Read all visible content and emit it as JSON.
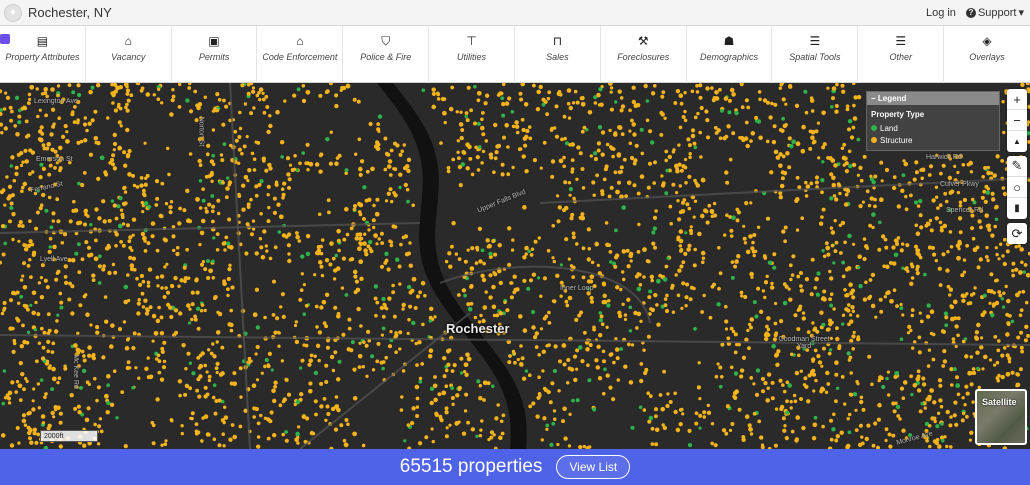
{
  "topbar": {
    "title": "Rochester, NY",
    "login_label": "Log in",
    "support_label": "Support",
    "support_icon": "question-circle-icon"
  },
  "nav": {
    "items": [
      {
        "icon": "building-icon",
        "glyph": "▤",
        "label": "Property Attributes"
      },
      {
        "icon": "house-vacant-icon",
        "glyph": "⌂",
        "label": "Vacancy"
      },
      {
        "icon": "permit-doc-icon",
        "glyph": "▣",
        "label": "Permits"
      },
      {
        "icon": "house-icon",
        "glyph": "⌂",
        "label": "Code Enforcement"
      },
      {
        "icon": "shield-icon",
        "glyph": "⛉",
        "label": "Police & Fire"
      },
      {
        "icon": "faucet-icon",
        "glyph": "⊤",
        "label": "Utilities"
      },
      {
        "icon": "sign-icon",
        "glyph": "⊓",
        "label": "Sales"
      },
      {
        "icon": "gavel-icon",
        "glyph": "⚒",
        "label": "Foreclosures"
      },
      {
        "icon": "people-icon",
        "glyph": "☗",
        "label": "Demographics"
      },
      {
        "icon": "sliders-icon",
        "glyph": "☰",
        "label": "Spatial Tools"
      },
      {
        "icon": "sliders-icon",
        "glyph": "☰",
        "label": "Other"
      },
      {
        "icon": "layers-icon",
        "glyph": "◈",
        "label": "Overlays"
      }
    ]
  },
  "map": {
    "city_label": "Rochester",
    "streets": [
      {
        "label": "Lexington Ave"
      },
      {
        "label": "Emerson St"
      },
      {
        "label": "Ferrano St"
      },
      {
        "label": "Lyell Ave"
      },
      {
        "label": "Mc Kee Rd"
      },
      {
        "label": "Norton St"
      },
      {
        "label": "Upper Falls Blvd"
      },
      {
        "label": "Harwick Rd"
      },
      {
        "label": "Culver Pkwy"
      },
      {
        "label": "Spencer Rd"
      },
      {
        "label": "Inner Loop"
      },
      {
        "label": "Goodman Street Yard"
      },
      {
        "label": "Monroe Ave"
      }
    ],
    "scale_label": "2000ft",
    "satellite_label": "Satellite",
    "colors": {
      "land": "#2db34a",
      "structure": "#f5b31b",
      "background": "#2a2a2a",
      "river": "#111111"
    }
  },
  "legend": {
    "header": "Legend",
    "title": "Property Type",
    "items": [
      {
        "label": "Land",
        "color": "#2db34a"
      },
      {
        "label": "Structure",
        "color": "#f5b31b"
      }
    ]
  },
  "controls": {
    "zoom_in": "+",
    "zoom_out": "−",
    "compass": "▲",
    "draw_line": "✎",
    "draw_circle": "○",
    "delete": "🗑",
    "refresh": "⟳"
  },
  "bottom": {
    "count_label": "65515 properties",
    "view_list_label": "View List"
  }
}
